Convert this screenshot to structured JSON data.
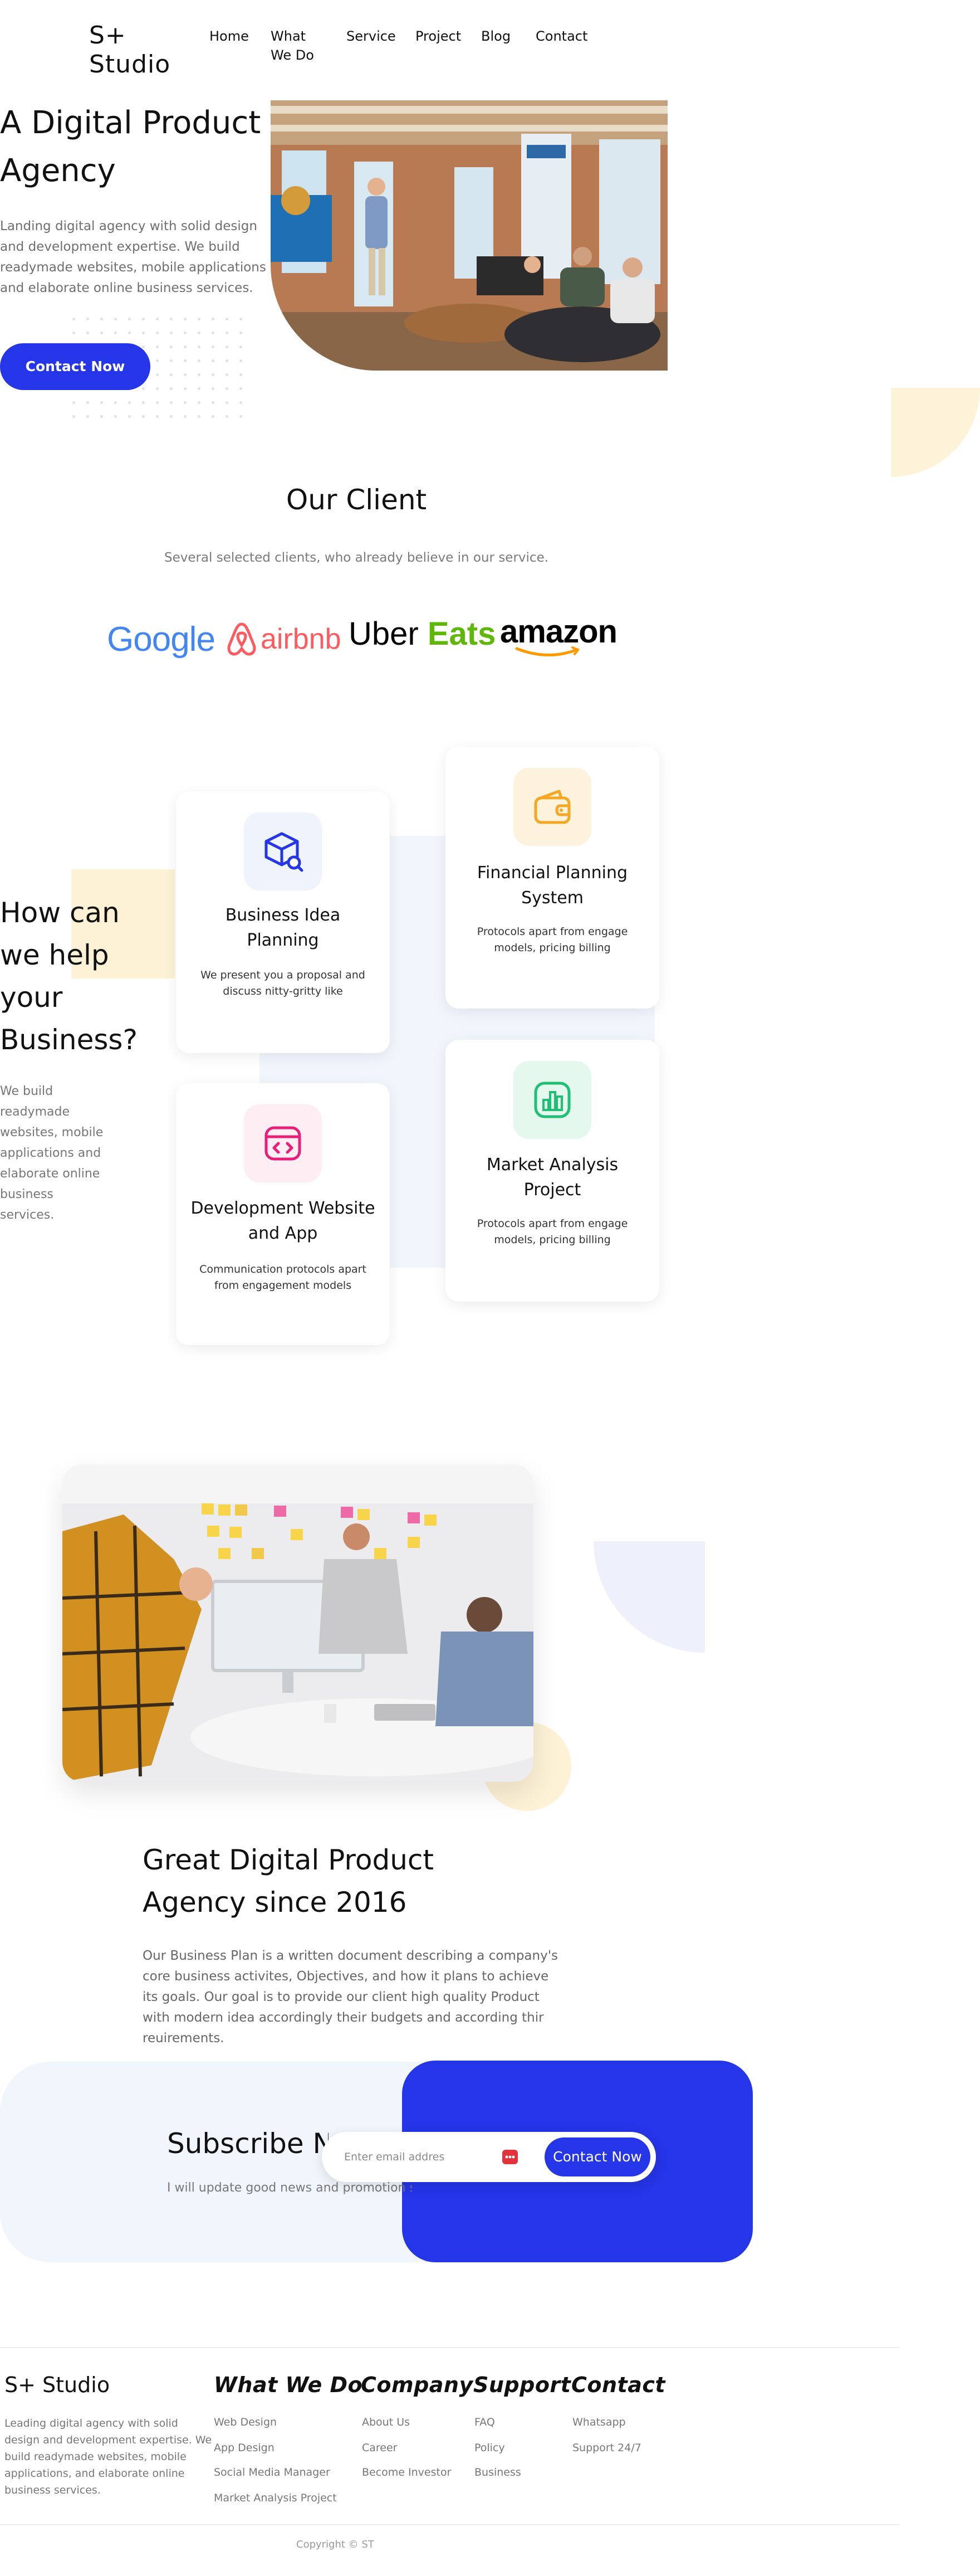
{
  "header": {
    "logo": "S+ Studio",
    "nav": [
      "Home",
      "What We Do",
      "Service",
      "Project",
      "Blog",
      "Contact"
    ]
  },
  "hero": {
    "title": "A Digital Product Agency",
    "description": "Landing digital agency with solid design and development expertise. We build readymade websites, mobile applications and elaborate online business services.",
    "cta": "Contact Now"
  },
  "clients": {
    "title": "Our Client",
    "subtitle": "Several selected clients, who already believe in our service.",
    "logos": [
      "Google",
      "airbnb",
      "Uber",
      "Eats",
      "amazon"
    ]
  },
  "services": {
    "title": "How can we help your Business?",
    "description": "We build readymade websites, mobile applications and elaborate online business services.",
    "cards": [
      {
        "title": "Business Idea Planning",
        "desc": "We present you a proposal and discuss nitty-gritty like"
      },
      {
        "title": "Financial Planning System",
        "desc": "Protocols apart from engage models, pricing billing"
      },
      {
        "title": "Development Website and App",
        "desc": "Communication protocols apart from engagement models"
      },
      {
        "title": "Market Analysis Project",
        "desc": "Protocols apart from engage models, pricing billing"
      }
    ]
  },
  "about": {
    "title": "Great Digital Product Agency since 2016",
    "description": "Our Business Plan is a written document describing a company's core business activites, Objectives, and how it plans to achieve its goals. Our goal is to provide our client high quality Product with modern idea accordingly their budgets and according thir reuirements."
  },
  "subscribe": {
    "title": "Subscribe Now",
    "description": "I will update good news and promotion service",
    "placeholder": "Enter email addres",
    "button": "Contact Now"
  },
  "footer": {
    "logo": "S+ Studio",
    "description": "Leading digital agency with solid design and development expertise. We build readymade websites, mobile applications, and elaborate online business services.",
    "columns": [
      {
        "title": "What We Do",
        "links": [
          "Web Design",
          "App Design",
          "Social Media Manager",
          "Market Analysis Project"
        ]
      },
      {
        "title": "Company",
        "links": [
          "About Us",
          "Career",
          "Become Investor"
        ]
      },
      {
        "title": "Support",
        "links": [
          "FAQ",
          "Policy",
          "Business"
        ]
      },
      {
        "title": "Contact",
        "links": [
          "Whatsapp",
          "Support 24/7"
        ]
      }
    ],
    "copyright": "Copyright © ST"
  },
  "colors": {
    "primary": "#2535e8",
    "yellow": "#fdf2d6",
    "light_blue": "#f1f6fd"
  }
}
